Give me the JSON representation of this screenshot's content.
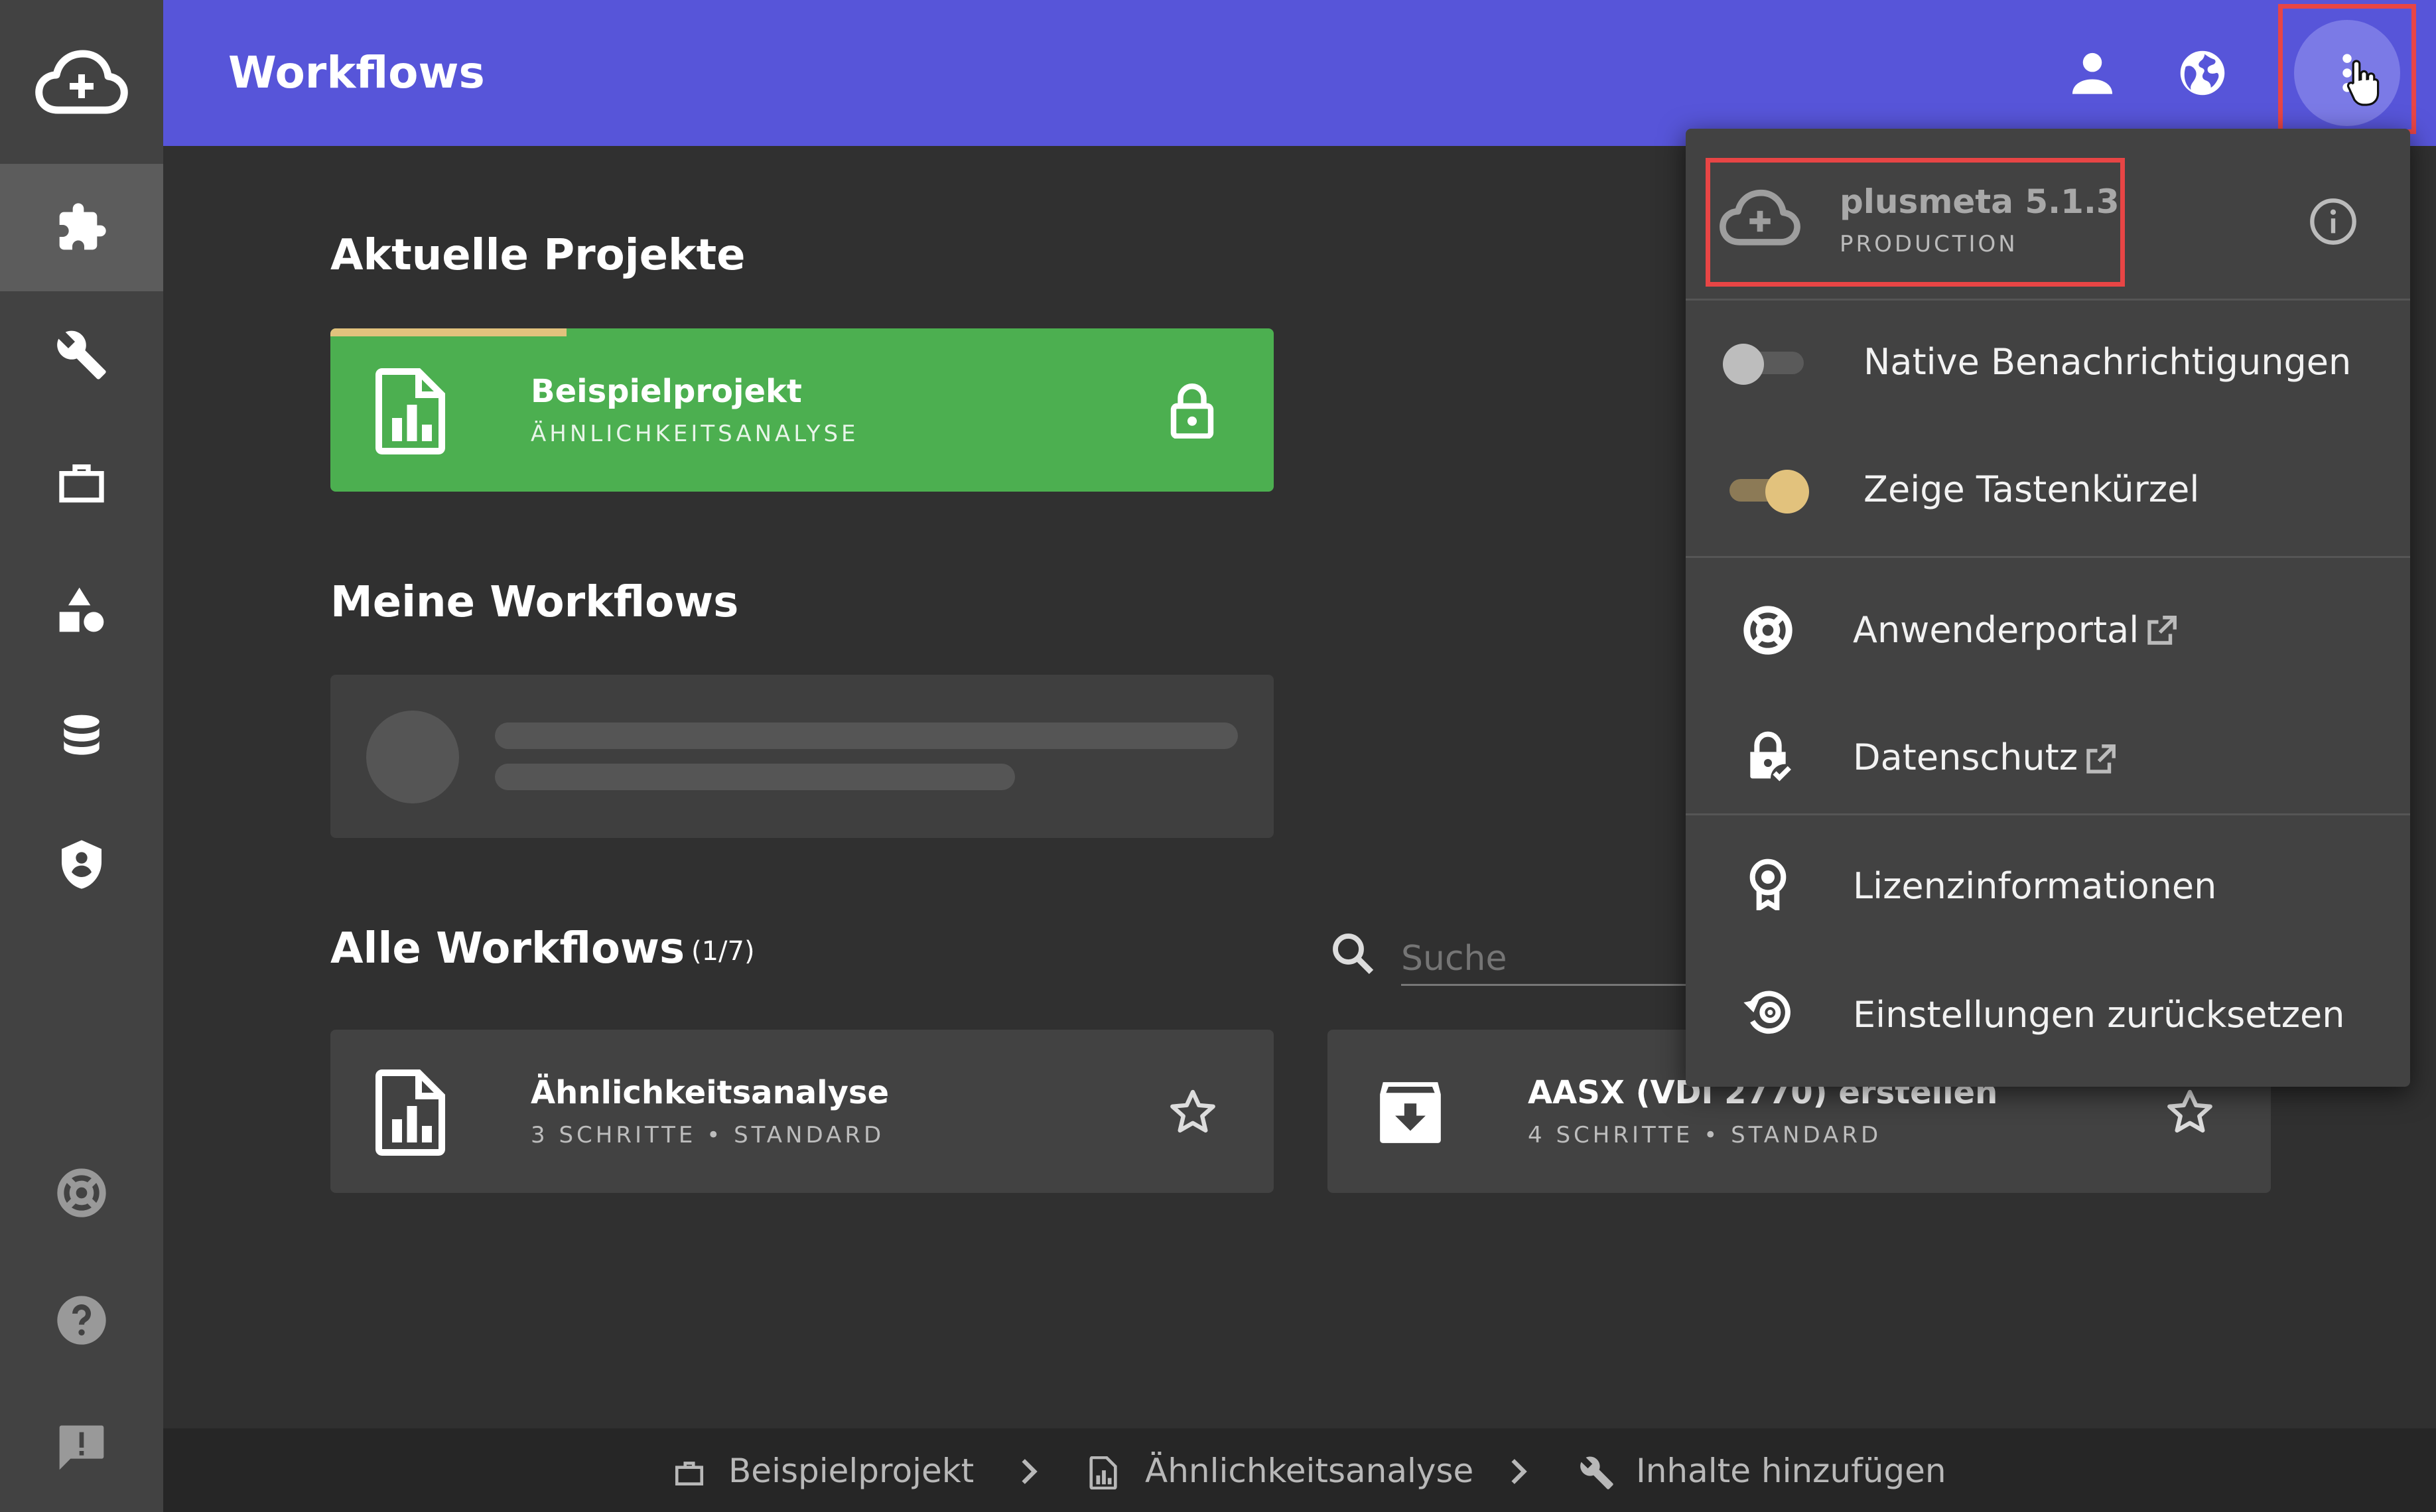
{
  "header": {
    "title": "Workflows"
  },
  "sections": {
    "recent": "Aktuelle Projekte",
    "mine": "Meine Workflows",
    "all": "Alle Workflows",
    "all_count": "(1/7)"
  },
  "recent_project": {
    "title": "Beispielprojekt",
    "subtitle": "ÄHNLICHKEITSANALYSE",
    "color": "#4caf50",
    "progress_fraction": 0.25
  },
  "search": {
    "placeholder": "Suche"
  },
  "workflows": [
    {
      "title": "Ähnlichkeitsanalyse",
      "subtitle": "3 SCHRITTE • STANDARD"
    },
    {
      "title": "AASX (VDI 2770) erstellen",
      "subtitle": "4 SCHRITTE • STANDARD"
    }
  ],
  "breadcrumb": {
    "items": [
      "Beispielprojekt",
      "Ähnlichkeitsanalyse",
      "Inhalte hinzufügen"
    ]
  },
  "menu": {
    "app_name": "plusmeta 5.1.3",
    "environment": "PRODUCTION",
    "toggles": [
      {
        "label": "Native Benachrichtigungen",
        "on": false
      },
      {
        "label": "Zeige Tastenkürzel",
        "on": true
      }
    ],
    "links": [
      {
        "label": "Anwenderportal",
        "external": true
      },
      {
        "label": "Datenschutz",
        "external": true
      }
    ],
    "actions": [
      {
        "label": "Lizenzinformationen"
      },
      {
        "label": "Einstellungen zurücksetzen"
      }
    ]
  },
  "colors": {
    "accent": "#5755d9",
    "toggle_on": "#e2c27d",
    "highlight": "#e84545"
  },
  "icons": {
    "sidebar": [
      "cloud-plus-icon",
      "puzzle-icon",
      "wrench-icon",
      "briefcase-icon",
      "shapes-icon",
      "database-icon",
      "shield-icon",
      "lifebuoy-icon",
      "help-icon",
      "feedback-icon"
    ],
    "header": [
      "account-icon",
      "globe-icon",
      "more-vertical-icon"
    ]
  }
}
